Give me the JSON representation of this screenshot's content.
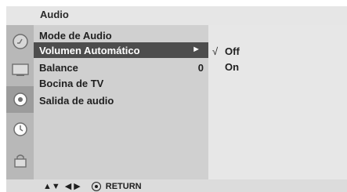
{
  "header": {
    "title": "Audio"
  },
  "sidebar_icons": [
    {
      "name": "audio-icon",
      "active": false
    },
    {
      "name": "screen-icon",
      "active": false
    },
    {
      "name": "disc-icon",
      "active": true
    },
    {
      "name": "clock-icon",
      "active": false
    },
    {
      "name": "lock-icon",
      "active": false
    }
  ],
  "menu": {
    "items": [
      {
        "label": "Mode de Audio",
        "value": "",
        "arrow": ""
      },
      {
        "label": "Volumen Automático",
        "value": "",
        "arrow": "►"
      },
      {
        "label": "Balance",
        "value": "0",
        "arrow": ""
      },
      {
        "label": "Bocina de TV",
        "value": "",
        "arrow": ""
      },
      {
        "label": "Salida de audio",
        "value": "",
        "arrow": ""
      }
    ],
    "selected_index": 1
  },
  "submenu": {
    "items": [
      {
        "label": "Off",
        "checked_mark": "√"
      },
      {
        "label": "On",
        "checked_mark": ""
      }
    ]
  },
  "footer": {
    "nav_updown": "▲▼",
    "nav_leftright": "◀ ▶",
    "return_label": "RETURN"
  }
}
